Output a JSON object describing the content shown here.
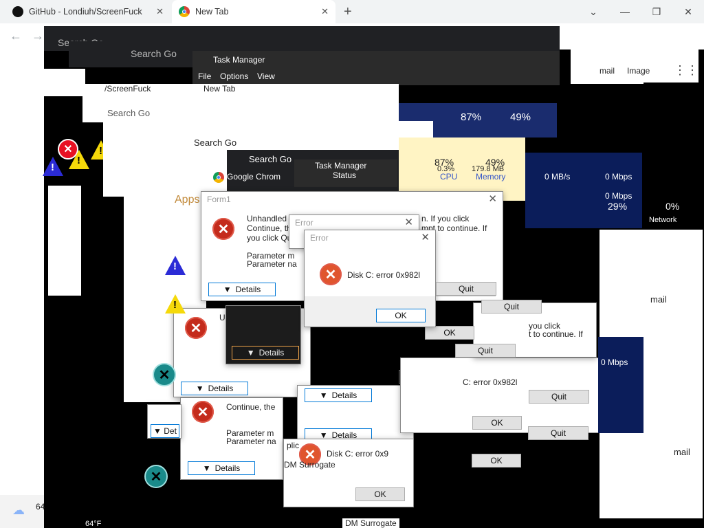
{
  "tabs": [
    {
      "title": "GitHub - Londiuh/ScreenFuck"
    },
    {
      "title": "New Tab"
    }
  ],
  "layers": {
    "search_label": "Search Go",
    "task_manager_title": "Task Manager",
    "tm_menu": [
      "File",
      "Options",
      "View"
    ],
    "tm_status": "Status",
    "cpu_pct": "87%",
    "mem_pct": "49%",
    "cpu_small": "0.3%",
    "mem_small": "179.8 MB",
    "cpu_label": "CPU",
    "mem_label": "Memory",
    "disk_rate": "0 MB/s",
    "net_rate": "0 Mbps",
    "net_pct": "29%",
    "net_zero": "0%",
    "network_label": "Network",
    "google_chrome": "Google Chrom",
    "apps": "Apps",
    "gmail": "mail",
    "images": "Image",
    "screenfuck_tab": "/ScreenFuck",
    "new_tab": "New Tab",
    "form1": "Form1",
    "com_surrogate": "DM Surrogate",
    "weather_temp": "64°F",
    "weather_short": "64",
    "replica_label": "plic"
  },
  "dialogs": {
    "form1_title": "Form1",
    "unhandled": "Unhandled e",
    "continue_text": "Continue, the",
    "you_click": "you click Qui",
    "param_msg": "Parameter m",
    "param_name": "Parameter na",
    "details": "Details",
    "quit": "Quit",
    "ok": "OK",
    "error_title": "Error",
    "disk_error": "Disk C: error 0x982l",
    "if_you_click": "n. If you click",
    "attempt_continue": "mpt to continue. If",
    "click_text": "you click",
    "to_continue": "t to continue. If",
    "disk_short": "C: error 0x982l",
    "disk_error2": "Disk C: error 0x9"
  }
}
